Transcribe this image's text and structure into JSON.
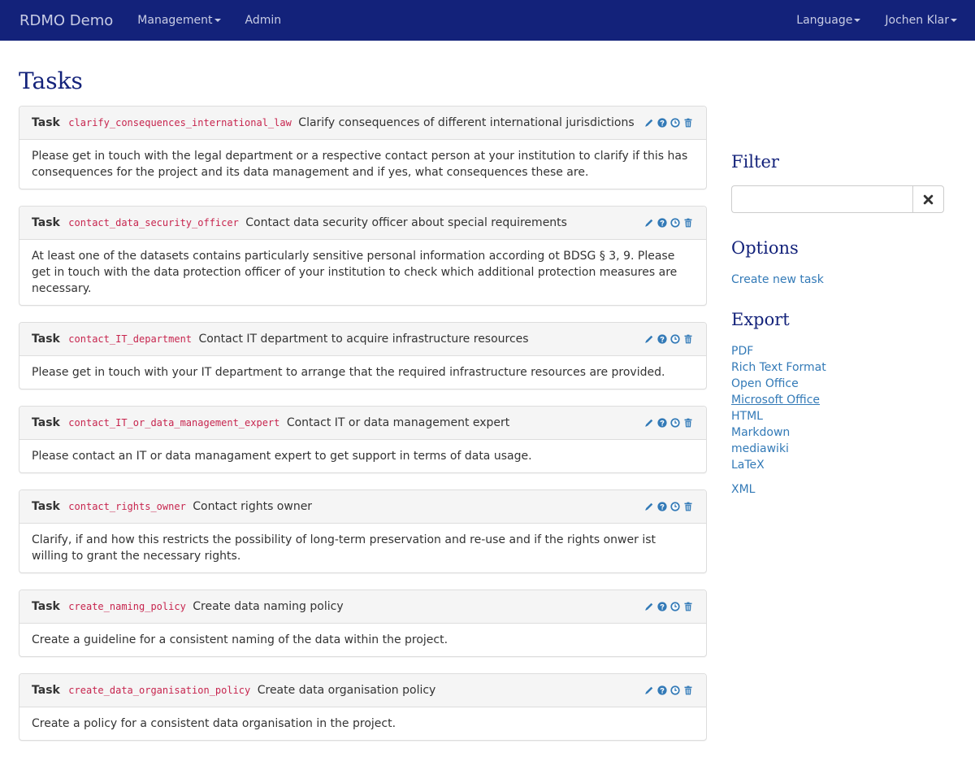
{
  "navbar": {
    "brand": "RDMO Demo",
    "management": "Management",
    "admin": "Admin",
    "language": "Language",
    "user": "Jochen Klar"
  },
  "page": {
    "title": "Tasks"
  },
  "tasks": [
    {
      "label": "Task",
      "key": "clarify_consequences_international_law",
      "title": "Clarify consequences of different international jurisdictions",
      "text": "Please get in touch with the legal department or a respective contact person at your institution to clarify if this has consequences for the project and its data management and if yes, what consequences these are."
    },
    {
      "label": "Task",
      "key": "contact_data_security_officer",
      "title": "Contact data security officer about special requirements",
      "text": "At least one of the datasets contains particularly sensitive personal information according ot BDSG § 3, 9. Please get in touch with the data protection officer of your institution to check which additional protection measures are necessary."
    },
    {
      "label": "Task",
      "key": "contact_IT_department",
      "title": "Contact IT department to acquire infrastructure resources",
      "text": "Please get in touch with your IT department to arrange that the required infrastructure resources are provided."
    },
    {
      "label": "Task",
      "key": "contact_IT_or_data_management_expert",
      "title": "Contact IT or data management expert",
      "text": "Please contact an IT or data managament expert to get support in terms of data usage."
    },
    {
      "label": "Task",
      "key": "contact_rights_owner",
      "title": "Contact rights owner",
      "text": "Clarify, if and how this restricts the possibility of long-term preservation and re-use and if the rights onwer ist willing to grant the necessary rights."
    },
    {
      "label": "Task",
      "key": "create_naming_policy",
      "title": "Create data naming policy",
      "text": "Create a guideline for a consistent naming of the data within the project."
    },
    {
      "label": "Task",
      "key": "create_data_organisation_policy",
      "title": "Create data organisation policy",
      "text": "Create a policy for a consistent data organisation in the project."
    }
  ],
  "icons": {
    "edit": "pencil-icon",
    "help": "question-circle-icon",
    "history": "clock-icon",
    "delete": "trash-icon",
    "clear": "close-icon"
  },
  "sidebar": {
    "filter_title": "Filter",
    "filter_value": "",
    "options_title": "Options",
    "options": [
      "Create new task"
    ],
    "export_title": "Export",
    "export_links": [
      "PDF",
      "Rich Text Format",
      "Open Office",
      "Microsoft Office",
      "HTML",
      "Markdown",
      "mediawiki",
      "LaTeX"
    ],
    "export_xml": "XML"
  },
  "colors": {
    "navbar": "#13227a",
    "heading": "#13227a",
    "link": "#337ab7",
    "code": "#c7254e"
  }
}
